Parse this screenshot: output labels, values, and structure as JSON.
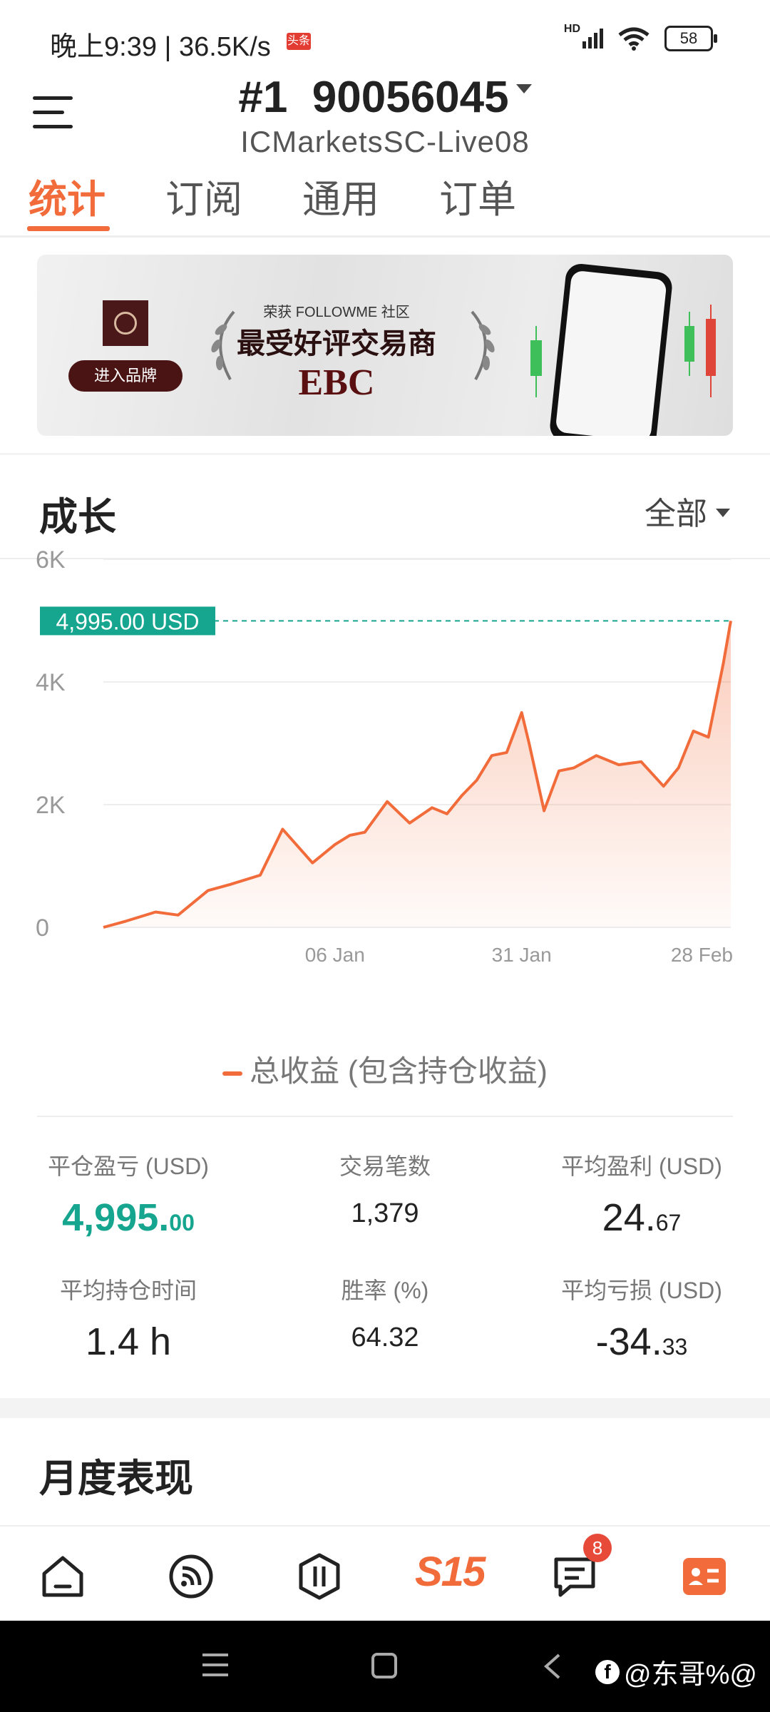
{
  "status_bar": {
    "time": "晚上9:39 | 36.5K/s",
    "tag": "头条",
    "signal": "HD",
    "battery": "58"
  },
  "header": {
    "account_title": "#1  90056045",
    "server": "ICMarketsSC-Live08",
    "tabs": [
      "统计",
      "订阅",
      "通用",
      "订单"
    ],
    "active_tab": "统计"
  },
  "banner": {
    "top_text": "荣获 FOLLOWME 社区",
    "main_text": "最受好评交易商",
    "brand_text": "EBC",
    "button_label": "进入品牌"
  },
  "growth": {
    "title": "成长",
    "range_label": "全部",
    "legend": "总收益 (包含持仓收益)"
  },
  "chart_data": {
    "type": "area",
    "x": [
      "2022-12-06",
      "2022-12-09",
      "2022-12-13",
      "2022-12-16",
      "2022-12-20",
      "2022-12-23",
      "2022-12-27",
      "2022-12-30",
      "2023-01-03",
      "2023-01-06",
      "2023-01-08",
      "2023-01-10",
      "2023-01-13",
      "2023-01-16",
      "2023-01-19",
      "2023-01-21",
      "2023-01-23",
      "2023-01-25",
      "2023-01-27",
      "2023-01-29",
      "2023-01-31",
      "2023-02-01",
      "2023-02-03",
      "2023-02-05",
      "2023-02-07",
      "2023-02-10",
      "2023-02-13",
      "2023-02-16",
      "2023-02-19",
      "2023-02-21",
      "2023-02-23",
      "2023-02-25",
      "2023-02-27",
      "2023-02-28"
    ],
    "y": [
      0,
      100,
      250,
      200,
      600,
      700,
      850,
      1600,
      1050,
      1350,
      1500,
      1550,
      2050,
      1700,
      1950,
      1850,
      2150,
      2400,
      2800,
      2850,
      3500,
      3000,
      1900,
      2550,
      2600,
      2800,
      2650,
      2700,
      2300,
      2600,
      3200,
      3100,
      4300,
      4995
    ],
    "y_ticks": [
      "6K",
      "4K",
      "2K",
      "0"
    ],
    "x_ticks": [
      "06 Jan",
      "31 Jan",
      "28 Feb"
    ],
    "ylim": [
      0,
      6000
    ],
    "current_label": "4,995.00 USD",
    "current_value": 4995,
    "series": [
      {
        "name": "总收益 (包含持仓收益)",
        "color": "#f26b3a"
      }
    ],
    "grid": true,
    "legend_position": "bottom"
  },
  "stats": [
    {
      "label": "平仓盈亏 (USD)",
      "int": "4,995.",
      "dec": "00"
    },
    {
      "label": "交易笔数",
      "value": "1,379"
    },
    {
      "label": "平均盈利 (USD)",
      "int": "24.",
      "dec": "67"
    },
    {
      "label": "平均持仓时间",
      "value": "1.4 h"
    },
    {
      "label": "胜率 (%)",
      "value": "64.32"
    },
    {
      "label": "平均亏损 (USD)",
      "int": "-34.",
      "dec": "33"
    }
  ],
  "monthly": {
    "title": "月度表现"
  },
  "bottom_nav": {
    "s15_label": "S15",
    "message_badge": "8"
  },
  "watermark": "@东哥%@",
  "colors": {
    "accent": "#f26b3a",
    "green": "#16a58f"
  }
}
